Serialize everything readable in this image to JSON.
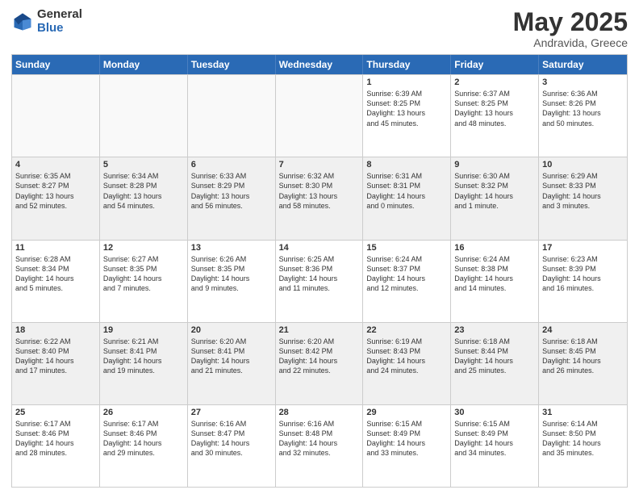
{
  "logo": {
    "general": "General",
    "blue": "Blue"
  },
  "title": "May 2025",
  "location": "Andravida, Greece",
  "header_days": [
    "Sunday",
    "Monday",
    "Tuesday",
    "Wednesday",
    "Thursday",
    "Friday",
    "Saturday"
  ],
  "weeks": [
    [
      {
        "day": "",
        "lines": []
      },
      {
        "day": "",
        "lines": []
      },
      {
        "day": "",
        "lines": []
      },
      {
        "day": "",
        "lines": []
      },
      {
        "day": "1",
        "lines": [
          "Sunrise: 6:39 AM",
          "Sunset: 8:25 PM",
          "Daylight: 13 hours",
          "and 45 minutes."
        ]
      },
      {
        "day": "2",
        "lines": [
          "Sunrise: 6:37 AM",
          "Sunset: 8:25 PM",
          "Daylight: 13 hours",
          "and 48 minutes."
        ]
      },
      {
        "day": "3",
        "lines": [
          "Sunrise: 6:36 AM",
          "Sunset: 8:26 PM",
          "Daylight: 13 hours",
          "and 50 minutes."
        ]
      }
    ],
    [
      {
        "day": "4",
        "lines": [
          "Sunrise: 6:35 AM",
          "Sunset: 8:27 PM",
          "Daylight: 13 hours",
          "and 52 minutes."
        ]
      },
      {
        "day": "5",
        "lines": [
          "Sunrise: 6:34 AM",
          "Sunset: 8:28 PM",
          "Daylight: 13 hours",
          "and 54 minutes."
        ]
      },
      {
        "day": "6",
        "lines": [
          "Sunrise: 6:33 AM",
          "Sunset: 8:29 PM",
          "Daylight: 13 hours",
          "and 56 minutes."
        ]
      },
      {
        "day": "7",
        "lines": [
          "Sunrise: 6:32 AM",
          "Sunset: 8:30 PM",
          "Daylight: 13 hours",
          "and 58 minutes."
        ]
      },
      {
        "day": "8",
        "lines": [
          "Sunrise: 6:31 AM",
          "Sunset: 8:31 PM",
          "Daylight: 14 hours",
          "and 0 minutes."
        ]
      },
      {
        "day": "9",
        "lines": [
          "Sunrise: 6:30 AM",
          "Sunset: 8:32 PM",
          "Daylight: 14 hours",
          "and 1 minute."
        ]
      },
      {
        "day": "10",
        "lines": [
          "Sunrise: 6:29 AM",
          "Sunset: 8:33 PM",
          "Daylight: 14 hours",
          "and 3 minutes."
        ]
      }
    ],
    [
      {
        "day": "11",
        "lines": [
          "Sunrise: 6:28 AM",
          "Sunset: 8:34 PM",
          "Daylight: 14 hours",
          "and 5 minutes."
        ]
      },
      {
        "day": "12",
        "lines": [
          "Sunrise: 6:27 AM",
          "Sunset: 8:35 PM",
          "Daylight: 14 hours",
          "and 7 minutes."
        ]
      },
      {
        "day": "13",
        "lines": [
          "Sunrise: 6:26 AM",
          "Sunset: 8:35 PM",
          "Daylight: 14 hours",
          "and 9 minutes."
        ]
      },
      {
        "day": "14",
        "lines": [
          "Sunrise: 6:25 AM",
          "Sunset: 8:36 PM",
          "Daylight: 14 hours",
          "and 11 minutes."
        ]
      },
      {
        "day": "15",
        "lines": [
          "Sunrise: 6:24 AM",
          "Sunset: 8:37 PM",
          "Daylight: 14 hours",
          "and 12 minutes."
        ]
      },
      {
        "day": "16",
        "lines": [
          "Sunrise: 6:24 AM",
          "Sunset: 8:38 PM",
          "Daylight: 14 hours",
          "and 14 minutes."
        ]
      },
      {
        "day": "17",
        "lines": [
          "Sunrise: 6:23 AM",
          "Sunset: 8:39 PM",
          "Daylight: 14 hours",
          "and 16 minutes."
        ]
      }
    ],
    [
      {
        "day": "18",
        "lines": [
          "Sunrise: 6:22 AM",
          "Sunset: 8:40 PM",
          "Daylight: 14 hours",
          "and 17 minutes."
        ]
      },
      {
        "day": "19",
        "lines": [
          "Sunrise: 6:21 AM",
          "Sunset: 8:41 PM",
          "Daylight: 14 hours",
          "and 19 minutes."
        ]
      },
      {
        "day": "20",
        "lines": [
          "Sunrise: 6:20 AM",
          "Sunset: 8:41 PM",
          "Daylight: 14 hours",
          "and 21 minutes."
        ]
      },
      {
        "day": "21",
        "lines": [
          "Sunrise: 6:20 AM",
          "Sunset: 8:42 PM",
          "Daylight: 14 hours",
          "and 22 minutes."
        ]
      },
      {
        "day": "22",
        "lines": [
          "Sunrise: 6:19 AM",
          "Sunset: 8:43 PM",
          "Daylight: 14 hours",
          "and 24 minutes."
        ]
      },
      {
        "day": "23",
        "lines": [
          "Sunrise: 6:18 AM",
          "Sunset: 8:44 PM",
          "Daylight: 14 hours",
          "and 25 minutes."
        ]
      },
      {
        "day": "24",
        "lines": [
          "Sunrise: 6:18 AM",
          "Sunset: 8:45 PM",
          "Daylight: 14 hours",
          "and 26 minutes."
        ]
      }
    ],
    [
      {
        "day": "25",
        "lines": [
          "Sunrise: 6:17 AM",
          "Sunset: 8:46 PM",
          "Daylight: 14 hours",
          "and 28 minutes."
        ]
      },
      {
        "day": "26",
        "lines": [
          "Sunrise: 6:17 AM",
          "Sunset: 8:46 PM",
          "Daylight: 14 hours",
          "and 29 minutes."
        ]
      },
      {
        "day": "27",
        "lines": [
          "Sunrise: 6:16 AM",
          "Sunset: 8:47 PM",
          "Daylight: 14 hours",
          "and 30 minutes."
        ]
      },
      {
        "day": "28",
        "lines": [
          "Sunrise: 6:16 AM",
          "Sunset: 8:48 PM",
          "Daylight: 14 hours",
          "and 32 minutes."
        ]
      },
      {
        "day": "29",
        "lines": [
          "Sunrise: 6:15 AM",
          "Sunset: 8:49 PM",
          "Daylight: 14 hours",
          "and 33 minutes."
        ]
      },
      {
        "day": "30",
        "lines": [
          "Sunrise: 6:15 AM",
          "Sunset: 8:49 PM",
          "Daylight: 14 hours",
          "and 34 minutes."
        ]
      },
      {
        "day": "31",
        "lines": [
          "Sunrise: 6:14 AM",
          "Sunset: 8:50 PM",
          "Daylight: 14 hours",
          "and 35 minutes."
        ]
      }
    ]
  ]
}
